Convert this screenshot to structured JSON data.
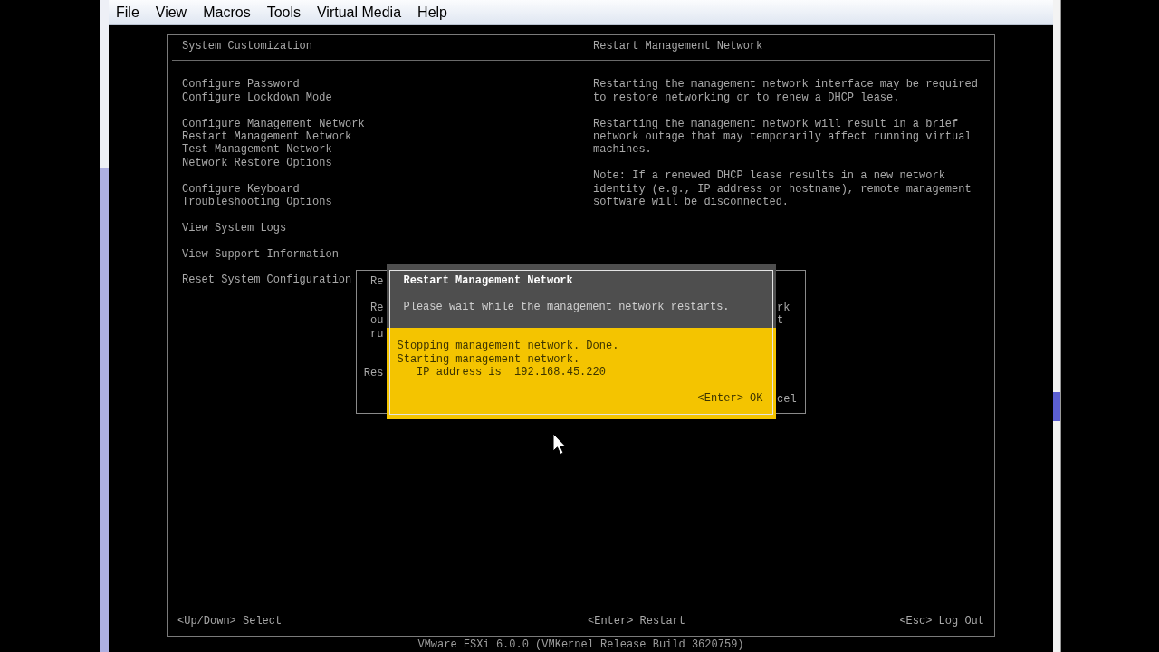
{
  "menu_bar": {
    "items": [
      "File",
      "View",
      "Macros",
      "Tools",
      "Virtual Media",
      "Help"
    ]
  },
  "console": {
    "left_header": "System Customization",
    "right_header": "Restart Management Network",
    "menu_groups": [
      {
        "items": [
          "Configure Password",
          "Configure Lockdown Mode"
        ]
      },
      {
        "items": [
          "Configure Management Network",
          "Restart Management Network",
          "Test Management Network",
          "Network Restore Options"
        ]
      },
      {
        "items": [
          "Configure Keyboard",
          "Troubleshooting Options"
        ]
      },
      {
        "items": [
          "View System Logs"
        ]
      },
      {
        "items": [
          "View Support Information"
        ]
      },
      {
        "items": [
          "Reset System Configuration"
        ]
      }
    ],
    "description": [
      "Restarting the management network interface may be required to restore networking or to renew a DHCP lease.",
      "Restarting the management network will result in a brief network outage that may temporarily affect running virtual machines.",
      "Note: If a renewed DHCP lease results in a new network identity (e.g., IP address or hostname), remote management software will be disconnected."
    ],
    "footer": [
      "<Up/Down> Select",
      "<Enter> Restart",
      "<Esc> Log Out"
    ],
    "version": "VMware ESXi 6.0.0 (VMKernel Release Build 3620759)"
  },
  "background_dialog": {
    "left_fragments": [
      "Re",
      "Re",
      "ou",
      "ru",
      "Res"
    ],
    "right_fragments": [
      "rk",
      "t",
      "cel"
    ]
  },
  "dialog": {
    "title": "Restart Management Network",
    "message": "Please wait while the management network restarts.",
    "status_lines": [
      {
        "text": "Stopping management network. Done.",
        "indented": false
      },
      {
        "text": "Starting management network.",
        "indented": false
      },
      {
        "text": "IP address is  192.168.45.220",
        "indented": true
      }
    ],
    "action": "<Enter> OK"
  }
}
